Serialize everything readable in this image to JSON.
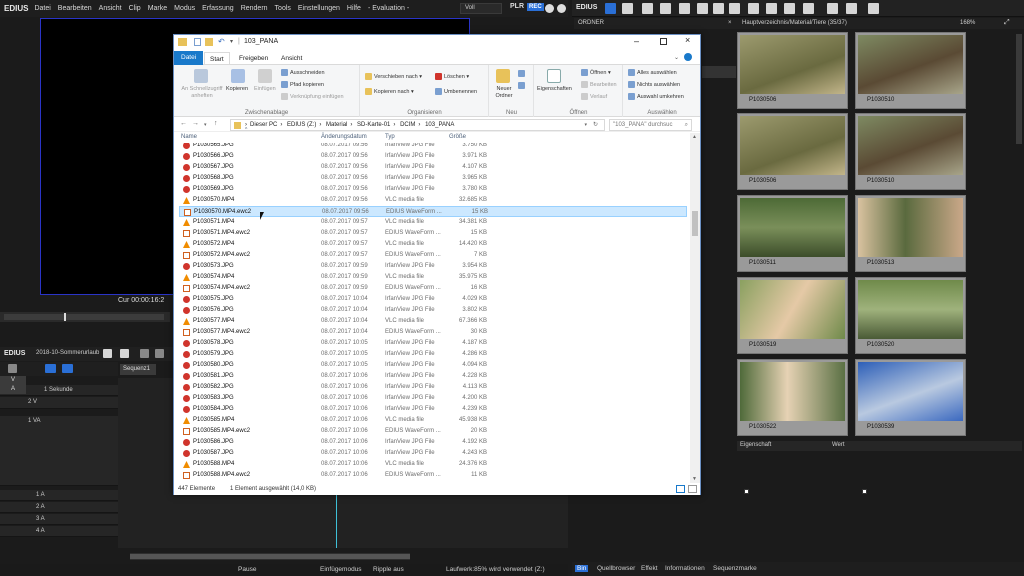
{
  "app": {
    "name": "EDIUS",
    "menu": [
      "Datei",
      "Bearbeiten",
      "Ansicht",
      "Clip",
      "Marke",
      "Modus",
      "Erfassung",
      "Rendern",
      "Tools",
      "Einstellungen",
      "Hilfe",
      "- Evaluation -"
    ],
    "mode_dropdown": "Voll",
    "plr": "PLR",
    "rec": "REC",
    "timecode": "Cur 00:00:16:2",
    "project": "2018-10-Sommerurlaub",
    "sequence_tab": "Sequenz1",
    "scale": "1 Sekunde",
    "tracks": [
      "2 V",
      "1 VA",
      "1 A",
      "2 A",
      "3 A",
      "4 A"
    ],
    "status": {
      "pause": "Pause",
      "insert": "Einfügemodus",
      "ripple": "Ripple aus",
      "drive": "Laufwerk:85% wird verwendet (Z:)"
    }
  },
  "bin": {
    "logo": "EDIUS",
    "folder_label": "ORDNER",
    "path": "Hauptverzeichnis/Material/Tiere (35/37)",
    "zoom": "168%",
    "thumbs": [
      {
        "label": "P1030506"
      },
      {
        "label": "P1030510"
      },
      {
        "label": "P1030506"
      },
      {
        "label": "P1030510"
      },
      {
        "label": "P1030511"
      },
      {
        "label": "P1030513"
      },
      {
        "label": "P1030519"
      },
      {
        "label": "P1030520"
      },
      {
        "label": "P1030522"
      },
      {
        "label": "P1030539"
      }
    ],
    "props": {
      "col1": "Eigenschaft",
      "col2": "Wert"
    },
    "tabs": [
      "Bin",
      "Quellbrowser",
      "Effekt",
      "Informationen",
      "Sequenzmarke"
    ]
  },
  "explorer": {
    "title": "103_PANA",
    "ribbon_tabs": {
      "file": "Datei",
      "start": "Start",
      "share": "Freigeben",
      "view": "Ansicht"
    },
    "clipboard": {
      "pin": "An Schnellzugriff anheften",
      "copy": "Kopieren",
      "paste": "Einfügen",
      "cut": "Ausschneiden",
      "copy_path": "Pfad kopieren",
      "paste_link": "Verknüpfung einfügen",
      "label": "Zwischenablage"
    },
    "organize": {
      "move": "Verschieben nach",
      "copy_to": "Kopieren nach",
      "delete": "Löschen",
      "rename": "Umbenennen",
      "label": "Organisieren"
    },
    "new": {
      "folder": "Neuer Ordner",
      "label": "Neu"
    },
    "open": {
      "props": "Eigenschaften",
      "open": "Öffnen",
      "edit": "Bearbeiten",
      "history": "Verlauf",
      "label": "Öffnen"
    },
    "select": {
      "all": "Alles auswählen",
      "none": "Nichts auswählen",
      "invert": "Auswahl umkehren",
      "label": "Auswählen"
    },
    "path": [
      "Dieser PC",
      "EDIUS (Z:)",
      "Material",
      "SD-Karte-01",
      "DCIM",
      "103_PANA"
    ],
    "search_placeholder": "\"103_PANA\" durchsuc",
    "columns": {
      "name": "Name",
      "date": "Änderungsdatum",
      "type": "Typ",
      "size": "Größe"
    },
    "files": [
      {
        "n": "P1030565.JPG",
        "d": "08.07.2017 09:56",
        "t": "IrfanView JPG File",
        "s": "3.750 KB",
        "k": "jpg"
      },
      {
        "n": "P1030566.JPG",
        "d": "08.07.2017 09:56",
        "t": "IrfanView JPG File",
        "s": "3.971 KB",
        "k": "jpg"
      },
      {
        "n": "P1030567.JPG",
        "d": "08.07.2017 09:56",
        "t": "IrfanView JPG File",
        "s": "4.107 KB",
        "k": "jpg"
      },
      {
        "n": "P1030568.JPG",
        "d": "08.07.2017 09:56",
        "t": "IrfanView JPG File",
        "s": "3.965 KB",
        "k": "jpg"
      },
      {
        "n": "P1030569.JPG",
        "d": "08.07.2017 09:56",
        "t": "IrfanView JPG File",
        "s": "3.780 KB",
        "k": "jpg"
      },
      {
        "n": "P1030570.MP4",
        "d": "08.07.2017 09:56",
        "t": "VLC media file",
        "s": "32.685 KB",
        "k": "vlc"
      },
      {
        "n": "P1030570.MP4.ewc2",
        "d": "08.07.2017 09:56",
        "t": "EDIUS WaveForm ...",
        "s": "15 KB",
        "k": "ewc",
        "sel": true
      },
      {
        "n": "P1030571.MP4",
        "d": "08.07.2017 09:57",
        "t": "VLC media file",
        "s": "34.381 KB",
        "k": "vlc"
      },
      {
        "n": "P1030571.MP4.ewc2",
        "d": "08.07.2017 09:57",
        "t": "EDIUS WaveForm ...",
        "s": "15 KB",
        "k": "ewc"
      },
      {
        "n": "P1030572.MP4",
        "d": "08.07.2017 09:57",
        "t": "VLC media file",
        "s": "14.420 KB",
        "k": "vlc"
      },
      {
        "n": "P1030572.MP4.ewc2",
        "d": "08.07.2017 09:57",
        "t": "EDIUS WaveForm ...",
        "s": "7 KB",
        "k": "ewc"
      },
      {
        "n": "P1030573.JPG",
        "d": "08.07.2017 09:59",
        "t": "IrfanView JPG File",
        "s": "3.954 KB",
        "k": "jpg"
      },
      {
        "n": "P1030574.MP4",
        "d": "08.07.2017 09:59",
        "t": "VLC media file",
        "s": "35.975 KB",
        "k": "vlc"
      },
      {
        "n": "P1030574.MP4.ewc2",
        "d": "08.07.2017 09:59",
        "t": "EDIUS WaveForm ...",
        "s": "16 KB",
        "k": "ewc"
      },
      {
        "n": "P1030575.JPG",
        "d": "08.07.2017 10:04",
        "t": "IrfanView JPG File",
        "s": "4.029 KB",
        "k": "jpg"
      },
      {
        "n": "P1030576.JPG",
        "d": "08.07.2017 10:04",
        "t": "IrfanView JPG File",
        "s": "3.802 KB",
        "k": "jpg"
      },
      {
        "n": "P1030577.MP4",
        "d": "08.07.2017 10:04",
        "t": "VLC media file",
        "s": "67.366 KB",
        "k": "vlc"
      },
      {
        "n": "P1030577.MP4.ewc2",
        "d": "08.07.2017 10:04",
        "t": "EDIUS WaveForm ...",
        "s": "30 KB",
        "k": "ewc"
      },
      {
        "n": "P1030578.JPG",
        "d": "08.07.2017 10:05",
        "t": "IrfanView JPG File",
        "s": "4.187 KB",
        "k": "jpg"
      },
      {
        "n": "P1030579.JPG",
        "d": "08.07.2017 10:05",
        "t": "IrfanView JPG File",
        "s": "4.286 KB",
        "k": "jpg"
      },
      {
        "n": "P1030580.JPG",
        "d": "08.07.2017 10:05",
        "t": "IrfanView JPG File",
        "s": "4.094 KB",
        "k": "jpg"
      },
      {
        "n": "P1030581.JPG",
        "d": "08.07.2017 10:06",
        "t": "IrfanView JPG File",
        "s": "4.228 KB",
        "k": "jpg"
      },
      {
        "n": "P1030582.JPG",
        "d": "08.07.2017 10:06",
        "t": "IrfanView JPG File",
        "s": "4.113 KB",
        "k": "jpg"
      },
      {
        "n": "P1030583.JPG",
        "d": "08.07.2017 10:06",
        "t": "IrfanView JPG File",
        "s": "4.200 KB",
        "k": "jpg"
      },
      {
        "n": "P1030584.JPG",
        "d": "08.07.2017 10:06",
        "t": "IrfanView JPG File",
        "s": "4.239 KB",
        "k": "jpg"
      },
      {
        "n": "P1030585.MP4",
        "d": "08.07.2017 10:06",
        "t": "VLC media file",
        "s": "45.938 KB",
        "k": "vlc"
      },
      {
        "n": "P1030585.MP4.ewc2",
        "d": "08.07.2017 10:06",
        "t": "EDIUS WaveForm ...",
        "s": "20 KB",
        "k": "ewc"
      },
      {
        "n": "P1030586.JPG",
        "d": "08.07.2017 10:06",
        "t": "IrfanView JPG File",
        "s": "4.192 KB",
        "k": "jpg"
      },
      {
        "n": "P1030587.JPG",
        "d": "08.07.2017 10:06",
        "t": "IrfanView JPG File",
        "s": "4.243 KB",
        "k": "jpg"
      },
      {
        "n": "P1030588.MP4",
        "d": "08.07.2017 10:06",
        "t": "VLC media file",
        "s": "24.376 KB",
        "k": "vlc"
      },
      {
        "n": "P1030588.MP4.ewc2",
        "d": "08.07.2017 10:06",
        "t": "EDIUS WaveForm ...",
        "s": "11 KB",
        "k": "ewc"
      }
    ],
    "status_count": "447 Elemente",
    "status_sel": "1 Element ausgewählt (14,0 KB)"
  },
  "colors": {
    "accent": "#1979ca",
    "rec": "#2a6fd6",
    "player_border": "#2a34c8"
  }
}
